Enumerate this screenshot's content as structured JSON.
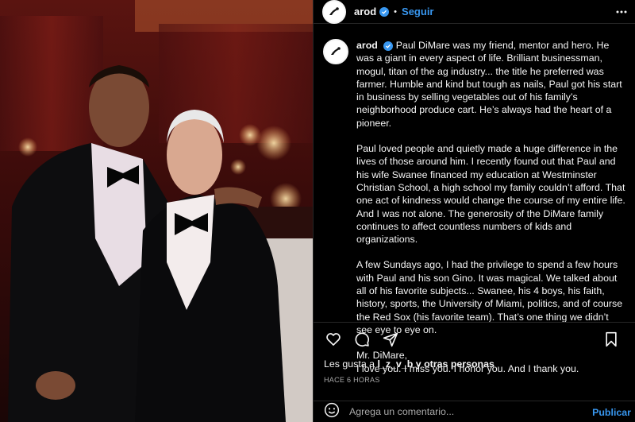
{
  "post": {
    "username": "arod",
    "follow_label": "Seguir",
    "separator": "•",
    "photo_alt": "Two men in tuxedos at a formal gala"
  },
  "caption": {
    "username": "arod",
    "paragraphs": [
      "Paul DiMare was my friend, mentor and hero. He was a giant in every aspect of life. Brilliant businessman, mogul, titan of the ag industry... the title he preferred was farmer. Humble and kind but tough as nails, Paul got his start in business by selling vegetables out of his family’s neighborhood produce cart. He’s always had the heart of a pioneer.",
      "Paul loved people and quietly made a huge difference in the lives of those around him. I recently found out that Paul and his wife Swanee financed my education at Westminster Christian School, a high school my family couldn’t afford. That one act of kindness would change the course of my entire life. And I was not alone. The generosity of the DiMare family continues to affect countless numbers of kids and organizations.",
      "A few Sundays ago, I had the privilege to spend a few hours with Paul and his son Gino. It was magical. We talked about all of his favorite subjects... Swanee, his 4 boys, his faith, history, sports, the University of Miami, politics, and of course the Red Sox (his favorite team).  That’s one thing we didn’t see eye to eye on."
    ],
    "closing_line1": "Mr. DiMare,",
    "closing_line2": "I love you. I miss you. I honor you. And I thank you."
  },
  "likes": {
    "prefix": "Les gusta a ",
    "user": "l_z_v_b",
    "suffix": " y otras personas"
  },
  "timestamp": "HACE 6 HORAS",
  "comment": {
    "placeholder": "Agrega un comentario...",
    "post_label": "Publicar"
  },
  "icons": {
    "more": "more-horizontal-icon",
    "like": "heart-icon",
    "comment": "comment-icon",
    "share": "send-icon",
    "save": "bookmark-icon",
    "emoji": "emoji-icon",
    "verified": "verified-badge-icon"
  },
  "colors": {
    "accent": "#3897f0",
    "background": "#000000",
    "text": "#f5f5f5",
    "muted": "#a8a8a8",
    "divider": "#262626"
  }
}
